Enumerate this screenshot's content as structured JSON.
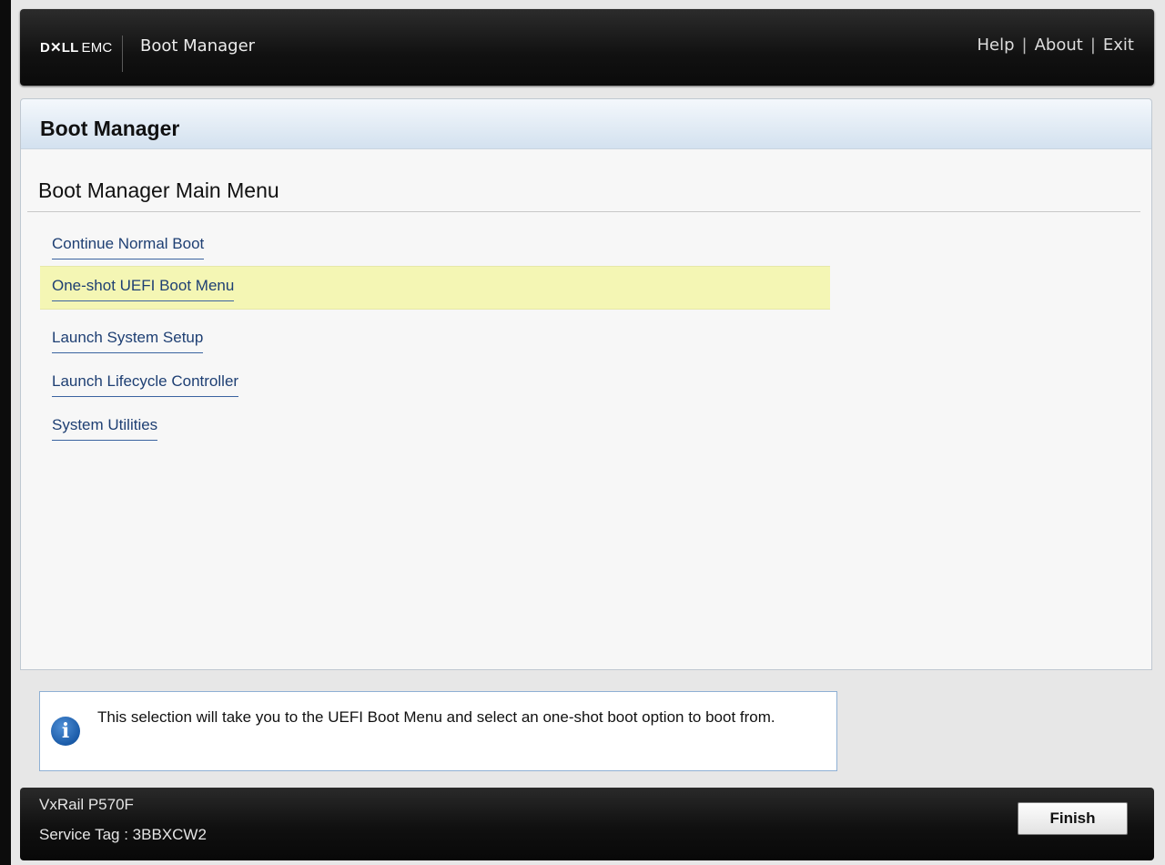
{
  "topbar": {
    "logo_dell": "D✕LL",
    "logo_emc": "EMC",
    "title": "Boot Manager",
    "links": {
      "help": "Help",
      "about": "About",
      "exit": "Exit",
      "separator": "|"
    }
  },
  "panel": {
    "header_title": "Boot Manager",
    "section_title": "Boot Manager Main Menu",
    "menu_items": [
      {
        "label": "Continue Normal Boot",
        "selected": false
      },
      {
        "label": "One-shot UEFI Boot Menu",
        "selected": true
      },
      {
        "label": "Launch System Setup",
        "selected": false
      },
      {
        "label": "Launch Lifecycle Controller",
        "selected": false
      },
      {
        "label": "System Utilities",
        "selected": false
      }
    ]
  },
  "info": {
    "icon": "info-icon",
    "text": "This selection will take you to the UEFI Boot Menu and select an one-shot boot option to boot from."
  },
  "footer": {
    "model": "VxRail P570F",
    "service_tag": "Service Tag : 3BBXCW2",
    "finish_label": "Finish"
  },
  "colors": {
    "selected_row": "#f4f6b4",
    "link": "#1e3f73",
    "header_gradient_end": "#d3e1ef",
    "info_icon": "#1a5ba8"
  }
}
